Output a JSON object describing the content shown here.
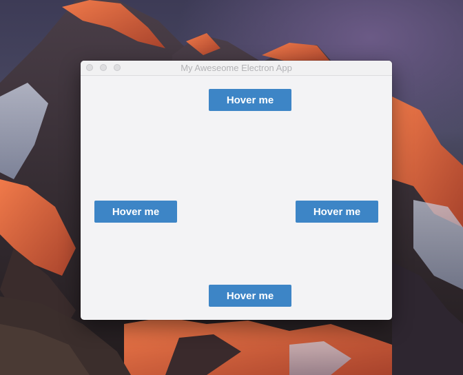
{
  "window": {
    "title": "My Aweseome Electron App"
  },
  "buttons": {
    "top": "Hover me",
    "left": "Hover me",
    "right": "Hover me",
    "bottom": "Hover me"
  },
  "colors": {
    "button_bg": "#3d85c6",
    "button_text": "#ffffff",
    "window_bg": "#f3f3f5"
  }
}
